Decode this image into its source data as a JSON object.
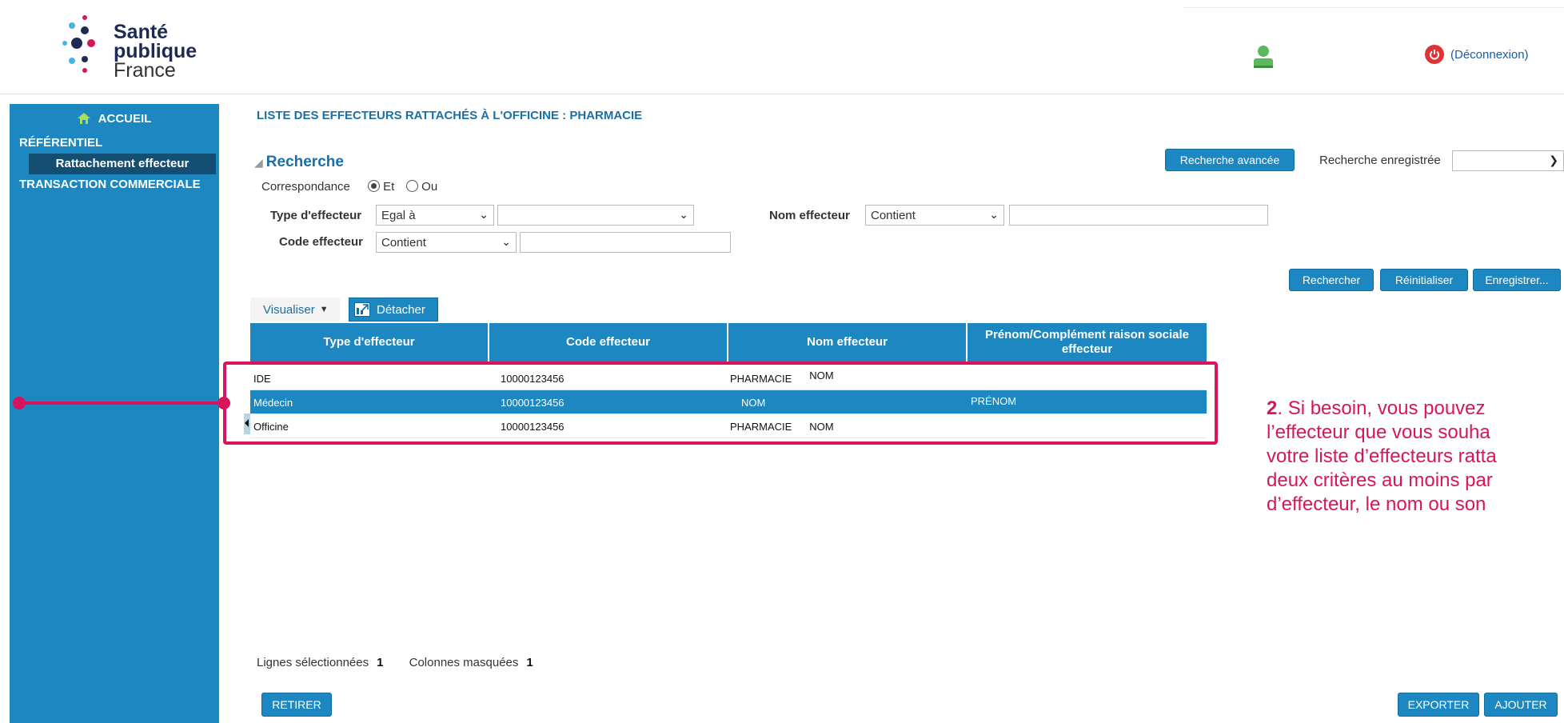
{
  "brand": {
    "line1": "Santé",
    "line2": "publique",
    "line3": "France"
  },
  "header": {
    "logout_label": "(Déconnexion)"
  },
  "sidebar": {
    "home": "ACCUEIL",
    "section1": "RÉFÉRENTIEL",
    "active_item": "Rattachement effecteur",
    "section2": "TRANSACTION COMMERCIALE"
  },
  "page": {
    "title": "LISTE DES EFFECTEURS RATTACHÉS À L'OFFICINE : PHARMACIE"
  },
  "search": {
    "heading": "Recherche",
    "advanced_btn": "Recherche avancée",
    "saved_label": "Recherche enregistrée",
    "saved_value": "",
    "correspondance_label": "Correspondance",
    "opt_et": "Et",
    "opt_ou": "Ou",
    "type_label": "Type d'effecteur",
    "type_operator": "Egal à",
    "type_value": "",
    "nom_label": "Nom effecteur",
    "nom_operator": "Contient",
    "nom_value": "",
    "code_label": "Code effecteur",
    "code_operator": "Contient",
    "code_value": "",
    "btn_rechercher": "Rechercher",
    "btn_reinitialiser": "Réinitialiser",
    "btn_enregistrer": "Enregistrer..."
  },
  "toolbar": {
    "visualiser": "Visualiser",
    "detacher": "Détacher"
  },
  "table": {
    "headers": [
      "Type d'effecteur",
      "Code effecteur",
      "Nom effecteur",
      "Prénom/Complément raison sociale effecteur"
    ],
    "rows": [
      {
        "type": "IDE",
        "code": "10000123456",
        "nom1": "PHARMACIE",
        "nom2": "NOM",
        "prenom": ""
      },
      {
        "type": "Médecin",
        "code": "10000123456",
        "nom1": "",
        "nom2": "NOM",
        "prenom": "PRÉNOM"
      },
      {
        "type": "Officine",
        "code": "10000123456",
        "nom1": "PHARMACIE",
        "nom2": "NOM",
        "prenom": ""
      }
    ]
  },
  "annotation": {
    "num": "2",
    "l1": ". Si besoin, vous pouvez",
    "l2": "l’effecteur que vous souha",
    "l3": "votre liste d’effecteurs ratta",
    "l4": "deux critères au moins par",
    "l5": "d’effecteur, le nom ou son"
  },
  "footer": {
    "selected_label": "Lignes sélectionnées",
    "selected_count": "1",
    "hidden_label": "Colonnes masquées",
    "hidden_count": "1",
    "btn_retirer": "RETIRER",
    "btn_exporter": "EXPORTER",
    "btn_ajouter": "AJOUTER"
  },
  "colors": {
    "primary": "#1c87c1",
    "dark": "#144e72",
    "accent": "#d8155c",
    "logout": "#e03434"
  }
}
